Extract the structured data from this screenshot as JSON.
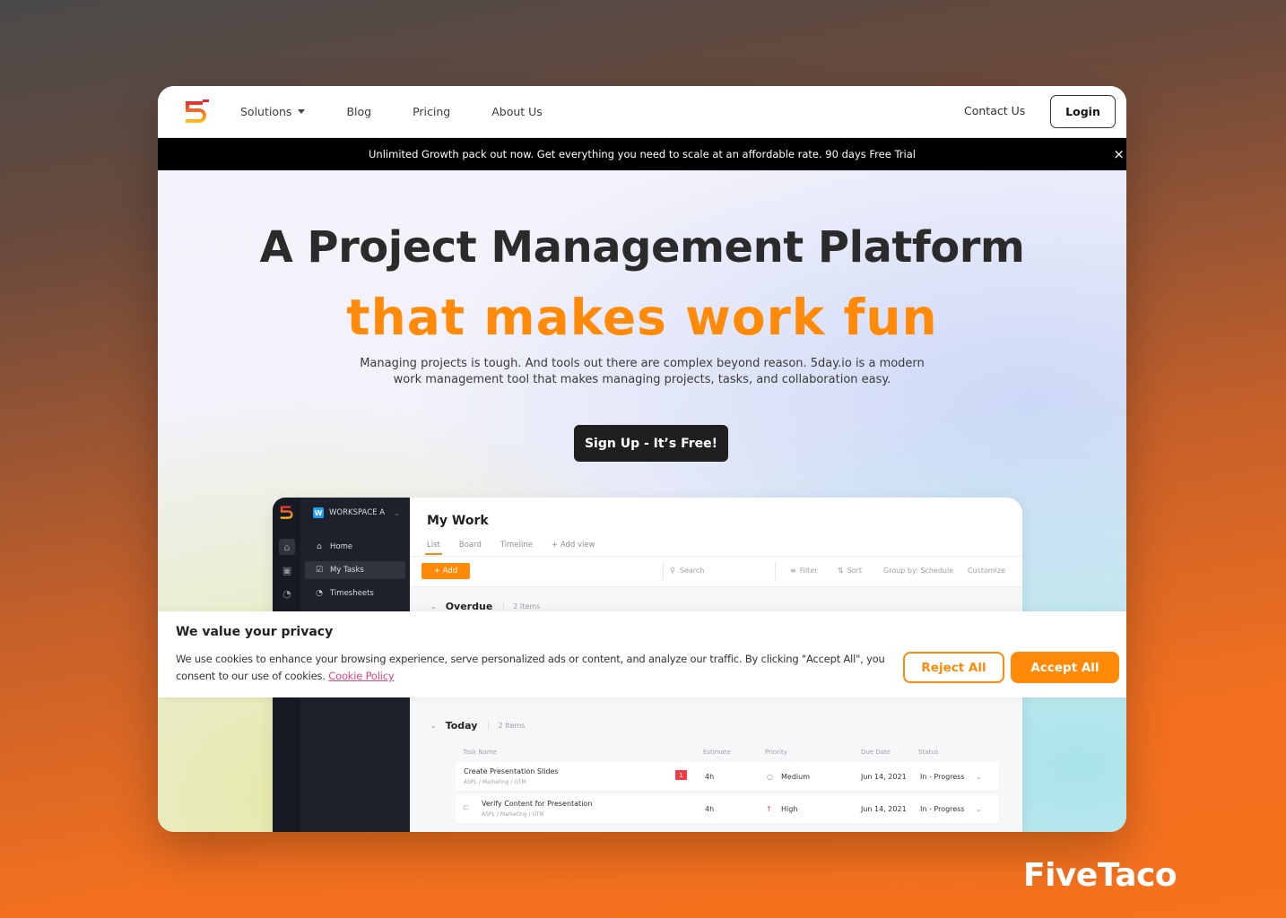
{
  "nav": {
    "logo": "5day-logo",
    "links": [
      "Solutions",
      "Blog",
      "Pricing",
      "About Us"
    ],
    "contact": "Contact Us",
    "login": "Login"
  },
  "banner": {
    "text": "Unlimited Growth pack out now. Get everything you need to scale at an affordable rate. 90 days Free Trial",
    "close": "×"
  },
  "hero": {
    "title": "A Project Management Platform",
    "subtitle": "that makes work fun",
    "description": "Managing projects is tough. And tools out there are complex beyond reason. 5day.io is a modern work management tool that makes managing projects, tasks, and collaboration easy.",
    "cta": "Sign Up - It’s Free!"
  },
  "app": {
    "workspace": {
      "badge": "W",
      "name": "WORKSPACE A"
    },
    "sidebar": [
      {
        "label": "Home",
        "icon": "home-icon"
      },
      {
        "label": "My Tasks",
        "icon": "checkbox-icon",
        "active": true
      },
      {
        "label": "Timesheets",
        "icon": "bell-icon"
      }
    ],
    "title": "My Work",
    "tabs": [
      "List",
      "Board",
      "Timeline",
      "+ Add view"
    ],
    "active_tab": "List",
    "add_button": "+ Add",
    "toolbar": {
      "search_placeholder": "Search",
      "filter": "Filter",
      "sort": "Sort",
      "group_by": "Group by: Schedule",
      "customize": "Customize"
    },
    "sections": [
      {
        "title": "Overdue",
        "count": "2 Items"
      },
      {
        "title": "Today",
        "count": "2 Items"
      }
    ],
    "columns": [
      "Task Name",
      "Estimate",
      "Priority",
      "Due Date",
      "Status"
    ],
    "tasks": [
      {
        "name": "Create Presentation Slides",
        "path": "ASPL / Marketing / GTM",
        "badge": "1",
        "estimate": "4h",
        "priority": "Medium",
        "priority_icon": "○",
        "due": "Jun 14, 2021",
        "status": "In - Progress"
      },
      {
        "name": "Verify Content for Presentation",
        "path": "ASPL / Marketing / GTM",
        "estimate": "4h",
        "priority": "High",
        "priority_icon": "↑",
        "due": "Jun 14, 2021",
        "status": "In - Progress"
      }
    ]
  },
  "cookie": {
    "title": "We value your privacy",
    "text": "We use cookies to enhance your browsing experience, serve personalized ads or content, and analyze our traffic. By clicking \"Accept All\", you consent to our use of cookies.",
    "link": "Cookie Policy",
    "reject": "Reject All",
    "accept": "Accept All"
  },
  "watermark": "FiveTaco",
  "colors": {
    "accent": "#ff8a0a",
    "dark": "#1f1f1f",
    "link": "#e0457b"
  }
}
